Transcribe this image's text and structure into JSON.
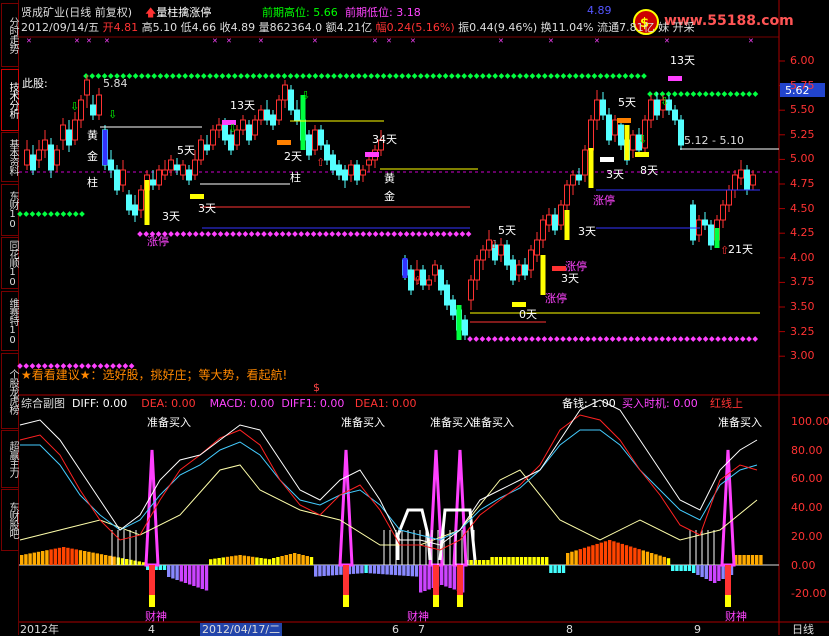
{
  "header": {
    "title": "贤成矿业(日线 前复权)",
    "pattern": "量柱擒涨停",
    "prev_high": "前期高位: 5.66",
    "prev_low": "前期低位: 3.18",
    "date": "2012/09/14/五",
    "open": "开4.81",
    "high": "高5.10",
    "low": "低4.66",
    "close": "收4.89",
    "volume": "量862364.0",
    "amount": "额4.21亿",
    "change": "幅0.24(5.16%)",
    "amplitude": "振0.44(9.46%)",
    "turnover": "换11.04%",
    "float": "流通7.81亿",
    "trailing": "亿",
    "tail": "妹",
    "tail2": "开采",
    "top_price": "4.89",
    "watermark": "www.55188.com",
    "this_stock": "此股:"
  },
  "sidebar": [
    "分时走势",
    "技术分析",
    "基本资料",
    "东财10",
    "同花顺10",
    "维赛特10",
    "个股龙虎榜",
    "超赢主力",
    "东财股吧"
  ],
  "price_axis": [
    "6.00",
    "5.75",
    "5.50",
    "5.25",
    "5.00",
    "4.75",
    "4.50",
    "4.25",
    "4.00",
    "3.75",
    "3.50",
    "3.25",
    "3.00"
  ],
  "current_price": "5.62",
  "price_annotations": {
    "high_label": "5.84",
    "range_label": "5.12 - 5.10",
    "days": [
      "13天",
      "5天",
      "2天",
      "34天",
      "3天",
      "5天",
      "3天",
      "0天",
      "5天",
      "3天",
      "8天",
      "13天",
      "3天",
      "21天",
      "3天"
    ],
    "tags": [
      "黄",
      "金",
      "柱",
      "涨停",
      "柱",
      "金",
      "黄"
    ],
    "limit_up": "涨停"
  },
  "ticker": {
    "text": "★看看建议★：选好股，挑好庄；等大势，看起航!",
    "dollar": "$"
  },
  "indicator": {
    "name": "综合副图",
    "diff": "DIFF: 0.00",
    "dea": "DEA: 0.00",
    "macd": "MACD: 0.00",
    "diff1": "DIFF1: 0.00",
    "dea1": "DEA1: 0.00",
    "reserve": "备钱: 1.00",
    "buy_time": "买入时机: 0.00",
    "red_line": "红线上",
    "prep_buy": "准备买入",
    "caishen": "财神",
    "axis": [
      "100.00",
      "80.00",
      "60.00",
      "40.00",
      "20.00",
      "0.00",
      "-20.00"
    ]
  },
  "time_axis": {
    "labels": [
      "2012年",
      "4",
      "2012/04/17/二",
      "6",
      "7",
      "8",
      "9"
    ],
    "unit": "日线"
  },
  "colors": {
    "up": "#ff3232",
    "down": "#54ffff",
    "green_dots": "#00ff40",
    "magenta": "#ff40ff",
    "yellow": "#ffff00"
  }
}
